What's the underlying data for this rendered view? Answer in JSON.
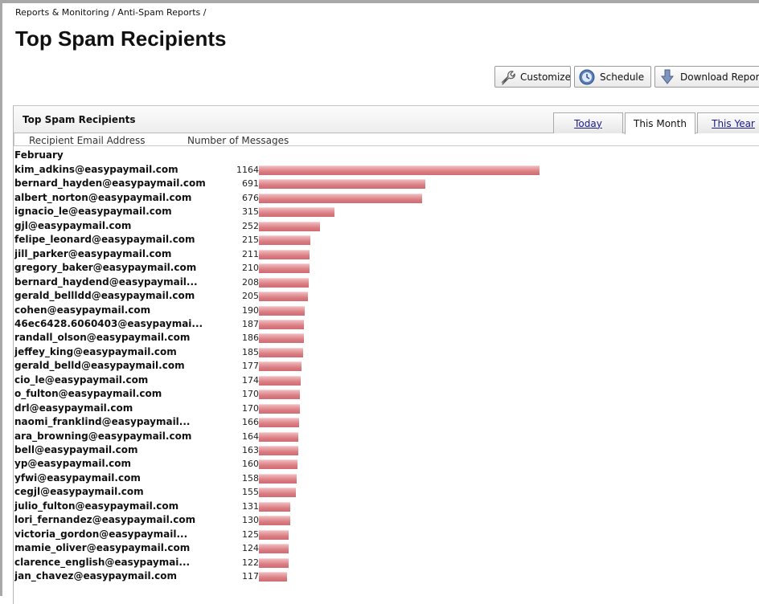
{
  "breadcrumb": "Reports & Monitoring / Anti-Spam Reports /",
  "page_title": "Top Spam Recipients",
  "toolbar": {
    "customize_label": "Customize",
    "customize_icon": "wrench-icon",
    "schedule_label": "Schedule",
    "schedule_icon": "clock-icon",
    "download_label": "Download Report",
    "download_icon": "download-arrow-icon"
  },
  "panel": {
    "title": "Top Spam Recipients",
    "tabs": [
      {
        "label": "Today",
        "active": false
      },
      {
        "label": "This Month",
        "active": true
      },
      {
        "label": "This Year",
        "active": false
      }
    ]
  },
  "columns": {
    "email": "Recipient Email Address",
    "count": "Number of Messages"
  },
  "colors": {
    "bar": "#d97c82",
    "link": "#1a1a8a"
  },
  "chart_data": {
    "type": "bar",
    "group": "February",
    "max_value": 1164,
    "rows": [
      {
        "email": "kim_adkins@easypaymail.com",
        "count": 1164
      },
      {
        "email": "bernard_hayden@easypaymail.com",
        "count": 691
      },
      {
        "email": "albert_norton@easypaymail.com",
        "count": 676
      },
      {
        "email": "ignacio_le@easypaymail.com",
        "count": 315
      },
      {
        "email": "gjl@easypaymail.com",
        "count": 252
      },
      {
        "email": "felipe_leonard@easypaymail.com",
        "count": 215
      },
      {
        "email": "jill_parker@easypaymail.com",
        "count": 211
      },
      {
        "email": "gregory_baker@easypaymail.com",
        "count": 210
      },
      {
        "email": "bernard_haydend@easypaymail...",
        "count": 208
      },
      {
        "email": "gerald_bellldd@easypaymail.com",
        "count": 205
      },
      {
        "email": "cohen@easypaymail.com",
        "count": 190
      },
      {
        "email": "46ec6428.6060403@easypaymai...",
        "count": 187
      },
      {
        "email": "randall_olson@easypaymail.com",
        "count": 186
      },
      {
        "email": "jeffey_king@easypaymail.com",
        "count": 185
      },
      {
        "email": "gerald_belld@easypaymail.com",
        "count": 177
      },
      {
        "email": "cio_le@easypaymail.com",
        "count": 174
      },
      {
        "email": "o_fulton@easypaymail.com",
        "count": 170
      },
      {
        "email": "drl@easypaymail.com",
        "count": 170
      },
      {
        "email": "naomi_franklind@easypaymail...",
        "count": 166
      },
      {
        "email": "ara_browning@easypaymail.com",
        "count": 164
      },
      {
        "email": "bell@easypaymail.com",
        "count": 163
      },
      {
        "email": "yp@easypaymail.com",
        "count": 160
      },
      {
        "email": "yfwi@easypaymail.com",
        "count": 158
      },
      {
        "email": "cegjl@easypaymail.com",
        "count": 155
      },
      {
        "email": "julio_fulton@easypaymail.com",
        "count": 131
      },
      {
        "email": "lori_fernandez@easypaymail.com",
        "count": 130
      },
      {
        "email": "victoria_gordon@easypaymail...",
        "count": 125
      },
      {
        "email": "mamie_oliver@easypaymail.com",
        "count": 124
      },
      {
        "email": "clarence_english@easypaymai...",
        "count": 122
      },
      {
        "email": "jan_chavez@easypaymail.com",
        "count": 117
      }
    ]
  }
}
